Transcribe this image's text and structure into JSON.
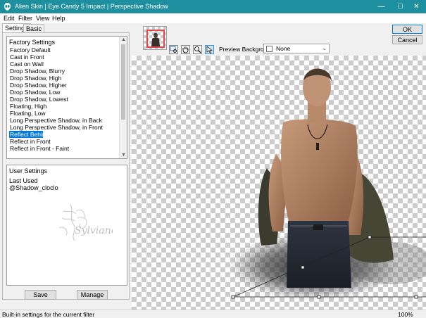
{
  "window": {
    "title": "Alien Skin | Eye Candy 5 Impact | Perspective Shadow",
    "min": "—",
    "max": "☐",
    "close": "✕"
  },
  "menu": [
    "Edit",
    "Filter",
    "View",
    "Help"
  ],
  "tabs": [
    "Settings",
    "Basic"
  ],
  "factory": {
    "header": "Factory Settings",
    "items": [
      "Factory Default",
      "Cast in Front",
      "Cast on Wall",
      "Drop Shadow, Blurry",
      "Drop Shadow, High",
      "Drop Shadow, Higher",
      "Drop Shadow, Low",
      "Drop Shadow, Lowest",
      "Floating, High",
      "Floating, Low",
      "Long Perspective Shadow, in Back",
      "Long Perspective Shadow, in Front",
      "Reflect Behind",
      "Reflect in Front",
      "Reflect in Front - Faint"
    ],
    "selected_index": 12
  },
  "user": {
    "header": "User Settings",
    "items": [
      "Last Used",
      "@Shadow_cloclo"
    ],
    "watermark": "Sylviane"
  },
  "buttons": {
    "save": "Save",
    "manage": "Manage",
    "ok": "OK",
    "cancel": "Cancel"
  },
  "preview": {
    "label": "Preview Background:",
    "value": "None"
  },
  "status": {
    "text": "Built-in settings for the current filter",
    "zoom": "100%"
  },
  "colors": {
    "titlebar": "#1e8f9e",
    "selection": "#0078d7",
    "thumb_border": "#e2484a"
  }
}
